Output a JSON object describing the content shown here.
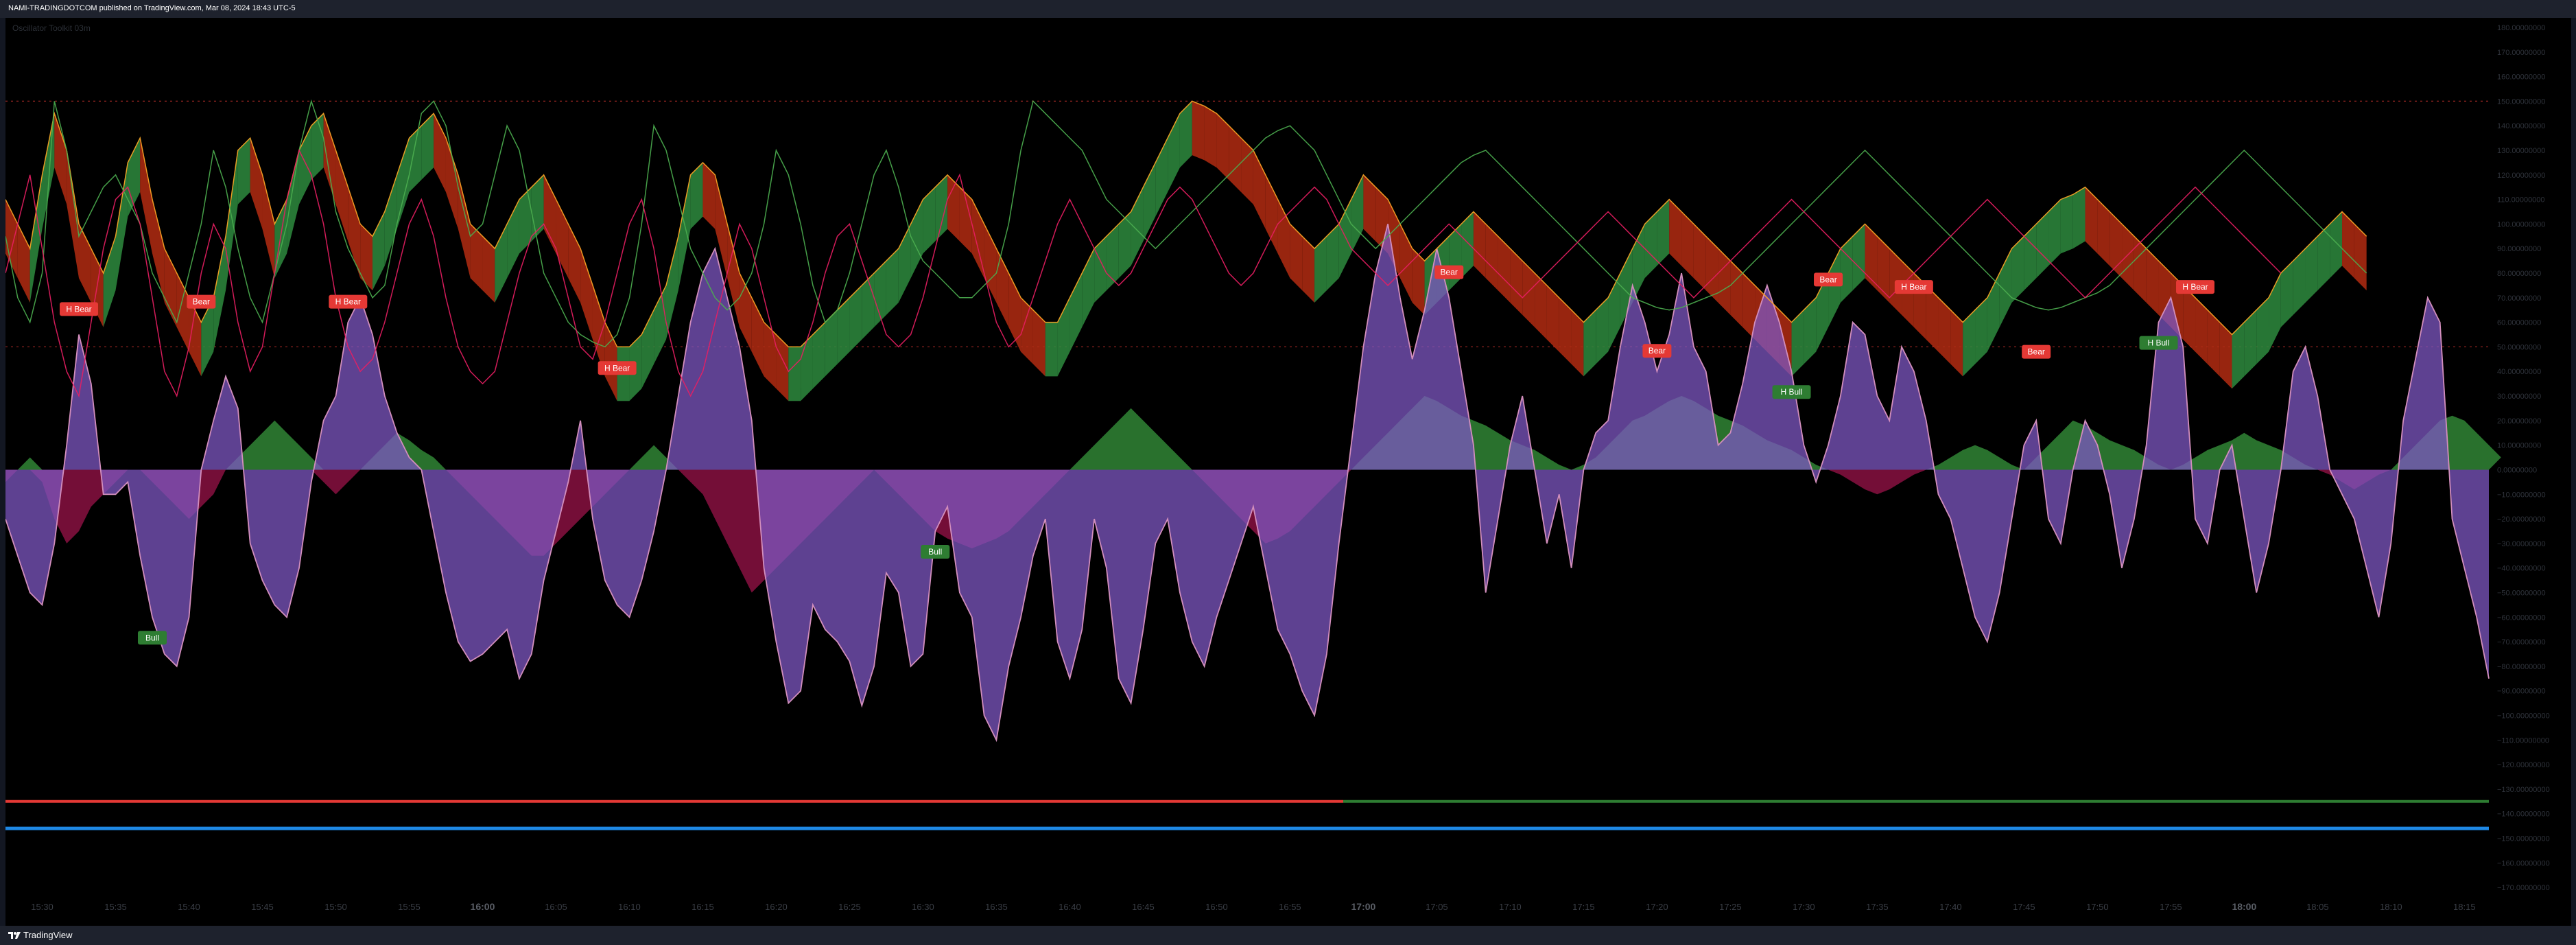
{
  "header": {
    "publish_text": "NAMI-TRADINGDOTCOM published on TradingView.com, Mar 08, 2024 18:43 UTC-5"
  },
  "watermark": "Oscillator Toolkit 03m",
  "footer": {
    "brand": "TradingView",
    "logo_icon": "tradingview-logo-icon"
  },
  "colors": {
    "background": "#000000",
    "frame": "#131722",
    "histogram": "#7e57c2",
    "histogram_line": "#d28ebc",
    "negative_zone": "#c2185b",
    "positive_zone": "#2e7d32",
    "bull": "#2e7d32",
    "bear": "#e53935",
    "fast_line": "#4caf50",
    "mid_line": "#e91e63",
    "slow_line": "#ffa726",
    "blue_line": "#1e88e5"
  },
  "chart_data": {
    "type": "line",
    "ylim": [
      -175,
      180
    ],
    "y_ticks": [
      180,
      170,
      160,
      150,
      140,
      130,
      120,
      110,
      100,
      90,
      80,
      70,
      60,
      50,
      40,
      30,
      20,
      10,
      0,
      -10,
      -20,
      -30,
      -40,
      -50,
      -60,
      -70,
      -80,
      -90,
      -100,
      -110,
      -120,
      -130,
      -140,
      -150,
      -160,
      -170
    ],
    "y_tick_labels": [
      "180.00000000",
      "170.00000000",
      "160.00000000",
      "150.00000000",
      "140.00000000",
      "130.00000000",
      "120.00000000",
      "110.00000000",
      "100.00000000",
      "90.00000000",
      "80.00000000",
      "70.00000000",
      "60.00000000",
      "50.00000000",
      "40.00000000",
      "30.00000000",
      "20.00000000",
      "10.00000000",
      "0.00000000",
      "−10.00000000",
      "−20.00000000",
      "−30.00000000",
      "−40.00000000",
      "−50.00000000",
      "−60.00000000",
      "−70.00000000",
      "−80.00000000",
      "−90.00000000",
      "−100.00000000",
      "−110.00000000",
      "−120.00000000",
      "−130.00000000",
      "−140.00000000",
      "−150.00000000",
      "−160.00000000",
      "−170.00000000"
    ],
    "x_tick_labels": [
      "15:30",
      "15:35",
      "15:40",
      "15:45",
      "15:50",
      "15:55",
      "16:00",
      "16:05",
      "16:10",
      "16:15",
      "16:20",
      "16:25",
      "16:30",
      "16:35",
      "16:40",
      "16:45",
      "16:50",
      "16:55",
      "17:00",
      "17:05",
      "17:10",
      "17:15",
      "17:20",
      "17:25",
      "17:30",
      "17:35",
      "17:40",
      "17:45",
      "17:50",
      "17:55",
      "18:00",
      "18:05",
      "18:10",
      "18:15"
    ],
    "x_tick_bold": [
      "16:00",
      "17:00",
      "18:00"
    ],
    "x_tick_bar_index": [
      3,
      9,
      15,
      21,
      27,
      33,
      39,
      45,
      51,
      57,
      63,
      69,
      75,
      81,
      87,
      93,
      99,
      105,
      111,
      117,
      123,
      129,
      135,
      141,
      147,
      153,
      159,
      165,
      171,
      177,
      183,
      189,
      195,
      201
    ],
    "reference_levels": [
      {
        "value": 150,
        "color": "#e53935"
      },
      {
        "value": 50,
        "color": "#e53935"
      }
    ],
    "series": [
      {
        "values": [
          -20,
          -35,
          -50,
          -55,
          -30,
          10,
          55,
          35,
          -10,
          -10,
          -5,
          -35,
          -60,
          -75,
          -80,
          -60,
          0,
          20,
          38,
          25,
          -30,
          -45,
          -55,
          -60,
          -40,
          -5,
          20,
          30,
          60,
          70,
          55,
          30,
          15,
          5,
          0,
          -25,
          -50,
          -70,
          -78,
          -75,
          -70,
          -65,
          -85,
          -75,
          -45,
          -25,
          -5,
          20,
          -20,
          -45,
          -55,
          -60,
          -45,
          -25,
          0,
          30,
          60,
          80,
          90,
          70,
          50,
          20,
          -40,
          -70,
          -95,
          -90,
          -55,
          -65,
          -70,
          -78,
          -96,
          -80,
          -42,
          -50,
          -80,
          -75,
          -25,
          -15,
          -50,
          -60,
          -100,
          -110,
          -80,
          -60,
          -35,
          -20,
          -70,
          -85,
          -65,
          -20,
          -40,
          -85,
          -95,
          -65,
          -30,
          -20,
          -50,
          -70,
          -80,
          -60,
          -45,
          -30,
          -15,
          -40,
          -65,
          -75,
          -90,
          -100,
          -75,
          -30,
          10,
          50,
          80,
          100,
          70,
          45,
          65,
          90,
          70,
          40,
          10,
          -50,
          -20,
          10,
          30,
          0,
          -30,
          -10,
          -40,
          0,
          15,
          20,
          50,
          75,
          60,
          40,
          55,
          80,
          50,
          40,
          10,
          15,
          35,
          60,
          75,
          60,
          40,
          10,
          -5,
          10,
          30,
          60,
          55,
          30,
          20,
          50,
          40,
          20,
          -10,
          -20,
          -40,
          -60,
          -70,
          -50,
          -20,
          10,
          20,
          -20,
          -30,
          0,
          20,
          10,
          -10,
          -40,
          -20,
          10,
          60,
          70,
          50,
          -20,
          -30,
          0,
          10,
          -20,
          -50,
          -30,
          0,
          40,
          50,
          30,
          0,
          -10,
          -20,
          -40,
          -60,
          -30,
          20,
          45,
          70,
          60,
          -20,
          -40,
          -60,
          -85
        ]
      },
      {
        "values": [
          -5,
          0,
          5,
          -5,
          -20,
          -30,
          -25,
          -15,
          -10,
          -5,
          0,
          0,
          -5,
          -10,
          -15,
          -20,
          -15,
          -10,
          0,
          5,
          10,
          15,
          20,
          15,
          10,
          5,
          -5,
          -10,
          -5,
          0,
          5,
          10,
          15,
          12,
          8,
          5,
          0,
          -5,
          -10,
          -15,
          -20,
          -25,
          -30,
          -35,
          -35,
          -30,
          -25,
          -20,
          -15,
          -10,
          -5,
          0,
          5,
          10,
          5,
          0,
          -5,
          -10,
          -20,
          -30,
          -40,
          -50,
          -45,
          -40,
          -35,
          -30,
          -25,
          -20,
          -15,
          -10,
          -5,
          0,
          -5,
          -10,
          -15,
          -20,
          -25,
          -28,
          -30,
          -32,
          -30,
          -28,
          -25,
          -20,
          -15,
          -10,
          -5,
          0,
          5,
          10,
          15,
          20,
          25,
          20,
          15,
          10,
          5,
          0,
          -5,
          -10,
          -15,
          -20,
          -25,
          -30,
          -28,
          -25,
          -20,
          -15,
          -10,
          -5,
          0,
          5,
          10,
          15,
          20,
          25,
          30,
          28,
          25,
          22,
          20,
          18,
          15,
          12,
          10,
          8,
          5,
          2,
          0,
          2,
          5,
          10,
          15,
          20,
          22,
          25,
          28,
          30,
          28,
          25,
          22,
          20,
          18,
          15,
          12,
          10,
          8,
          5,
          2,
          0,
          -2,
          -5,
          -8,
          -10,
          -8,
          -5,
          -2,
          0,
          2,
          5,
          8,
          10,
          8,
          5,
          2,
          0,
          5,
          10,
          15,
          20,
          18,
          15,
          12,
          10,
          8,
          5,
          2,
          0,
          2,
          5,
          8,
          10,
          12,
          15,
          12,
          10,
          8,
          5,
          2,
          0,
          -2,
          -5,
          -8,
          -5,
          -2,
          0,
          5,
          10,
          15,
          20,
          22,
          20,
          15,
          10,
          5
        ]
      },
      {
        "values": [
          110,
          100,
          90,
          120,
          145,
          130,
          100,
          90,
          80,
          95,
          125,
          135,
          110,
          90,
          80,
          70,
          60,
          70,
          95,
          130,
          135,
          120,
          100,
          110,
          130,
          140,
          145,
          130,
          115,
          100,
          95,
          105,
          120,
          135,
          140,
          145,
          135,
          120,
          100,
          95,
          90,
          100,
          110,
          115,
          120,
          110,
          100,
          90,
          75,
          60,
          50,
          50,
          55,
          65,
          75,
          95,
          120,
          125,
          120,
          100,
          80,
          70,
          60,
          55,
          50,
          50,
          55,
          60,
          65,
          70,
          75,
          80,
          85,
          90,
          100,
          110,
          115,
          120,
          115,
          110,
          100,
          90,
          80,
          70,
          65,
          60,
          60,
          70,
          80,
          90,
          95,
          100,
          105,
          115,
          125,
          135,
          145,
          150,
          148,
          145,
          140,
          135,
          130,
          120,
          110,
          100,
          95,
          90,
          95,
          100,
          110,
          120,
          115,
          110,
          100,
          90,
          85,
          90,
          95,
          100,
          105,
          100,
          95,
          90,
          85,
          80,
          75,
          70,
          65,
          60,
          65,
          70,
          80,
          90,
          100,
          105,
          110,
          105,
          100,
          95,
          90,
          85,
          80,
          75,
          70,
          65,
          60,
          65,
          70,
          80,
          90,
          95,
          100,
          95,
          90,
          85,
          80,
          75,
          70,
          65,
          60,
          65,
          70,
          80,
          90,
          95,
          100,
          105,
          110,
          112,
          115,
          110,
          105,
          100,
          95,
          90,
          85,
          80,
          75,
          70,
          65,
          60,
          55,
          60,
          65,
          70,
          80,
          85,
          90,
          95,
          100,
          105,
          100,
          95
        ]
      },
      {
        "values": [
          95,
          70,
          60,
          80,
          150,
          130,
          95,
          105,
          115,
          120,
          110,
          100,
          80,
          70,
          60,
          80,
          100,
          130,
          115,
          90,
          70,
          60,
          80,
          100,
          130,
          150,
          135,
          105,
          90,
          80,
          70,
          75,
          100,
          120,
          145,
          150,
          140,
          115,
          95,
          100,
          120,
          140,
          130,
          105,
          80,
          70,
          60,
          55,
          52,
          50,
          55,
          70,
          100,
          140,
          130,
          110,
          90,
          80,
          70,
          65,
          70,
          80,
          100,
          130,
          120,
          100,
          75,
          60,
          65,
          80,
          100,
          120,
          130,
          115,
          95,
          85,
          80,
          75,
          70,
          70,
          75,
          80,
          100,
          130,
          150,
          145,
          140,
          135,
          130,
          120,
          110,
          105,
          100,
          95,
          90,
          95,
          100,
          105,
          110,
          115,
          120,
          125,
          130,
          135,
          138,
          140,
          135,
          130,
          120,
          110,
          100,
          95,
          90,
          95,
          100,
          105,
          110,
          115,
          120,
          125,
          128,
          130,
          125,
          120,
          115,
          110,
          105,
          100,
          95,
          90,
          85,
          80,
          75,
          70,
          68,
          66,
          65,
          66,
          68,
          70,
          72,
          75,
          80,
          85,
          90,
          95,
          100,
          105,
          110,
          115,
          120,
          125,
          130,
          125,
          120,
          115,
          110,
          105,
          100,
          95,
          90,
          85,
          80,
          75,
          70,
          68,
          66,
          65,
          66,
          68,
          70,
          72,
          75,
          80,
          85,
          90,
          95,
          100,
          105,
          110,
          115,
          120,
          125,
          130,
          125,
          120,
          115,
          110,
          105,
          100,
          95,
          90,
          85,
          80
        ]
      },
      {
        "values": [
          80,
          100,
          120,
          90,
          60,
          40,
          30,
          60,
          90,
          110,
          115,
          100,
          70,
          40,
          30,
          50,
          80,
          100,
          90,
          60,
          40,
          50,
          80,
          110,
          130,
          120,
          100,
          70,
          50,
          40,
          45,
          60,
          80,
          100,
          110,
          95,
          70,
          50,
          40,
          35,
          40,
          60,
          80,
          95,
          100,
          90,
          70,
          50,
          45,
          60,
          80,
          100,
          110,
          90,
          60,
          40,
          30,
          40,
          60,
          80,
          100,
          90,
          70,
          50,
          40,
          45,
          60,
          80,
          95,
          100,
          85,
          70,
          55,
          50,
          55,
          70,
          90,
          110,
          120,
          100,
          80,
          60,
          50,
          55,
          70,
          85,
          100,
          110,
          100,
          90,
          80,
          75,
          80,
          90,
          100,
          110,
          115,
          110,
          100,
          90,
          80,
          75,
          80,
          90,
          100,
          105,
          110,
          115,
          110,
          100,
          90,
          85,
          80,
          75,
          80,
          85,
          90,
          95,
          100,
          95,
          90,
          85,
          80,
          75,
          70,
          75,
          80,
          85,
          90,
          95,
          100,
          105,
          100,
          95,
          90,
          85,
          80,
          75,
          70,
          75,
          80,
          85,
          90,
          95,
          100,
          105,
          110,
          105,
          100,
          95,
          90,
          85,
          80,
          75,
          70,
          75,
          80,
          85,
          90,
          95,
          100,
          105,
          110,
          105,
          100,
          95,
          90,
          85,
          80,
          75,
          70,
          75,
          80,
          85,
          90,
          95,
          100,
          105,
          110,
          115,
          110,
          105,
          100,
          95,
          90,
          85,
          80
        ]
      }
    ],
    "signals": [
      {
        "label": "H Bear",
        "bar": 6
      },
      {
        "label": "Bear",
        "bar": 16
      },
      {
        "label": "H Bear",
        "bar": 28
      },
      {
        "label": "H Bear",
        "bar": 50
      },
      {
        "label": "Bear",
        "bar": 118
      },
      {
        "label": "Bear",
        "bar": 135
      },
      {
        "label": "Bear",
        "bar": 149
      },
      {
        "label": "H Bear",
        "bar": 156
      },
      {
        "label": "Bear",
        "bar": 166
      },
      {
        "label": "H Bear",
        "bar": 179
      },
      {
        "label": "Bull",
        "bar": 12
      },
      {
        "label": "Bull",
        "bar": 76
      },
      {
        "label": "H Bull",
        "bar": 146
      },
      {
        "label": "H Bull",
        "bar": 176
      }
    ]
  }
}
